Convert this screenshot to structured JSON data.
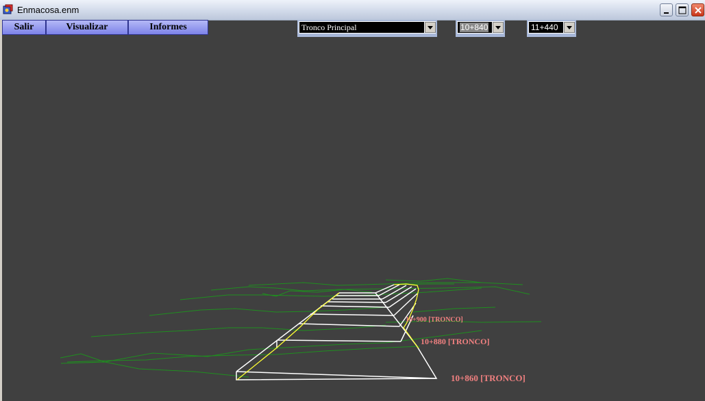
{
  "window": {
    "title": "Enmacosa.enm"
  },
  "menu": {
    "salir": "Salir",
    "visualizar": "Visualizar",
    "informes": "Informes"
  },
  "selectors": {
    "section": "Tronco Principal",
    "from_station": "10+840",
    "to_station": "11+440"
  },
  "viewport": {
    "labels": {
      "station_10860": "10+860 [TRONCO]",
      "station_10880": "10+880 [TRONCO]",
      "station_10900": "10+900 [TRONCO]"
    },
    "colors": {
      "background": "#404040",
      "terrain": "#1f8f1f",
      "road_outline": "#ffffff",
      "slope": "#ffff33",
      "station_label": "#f08080"
    }
  }
}
